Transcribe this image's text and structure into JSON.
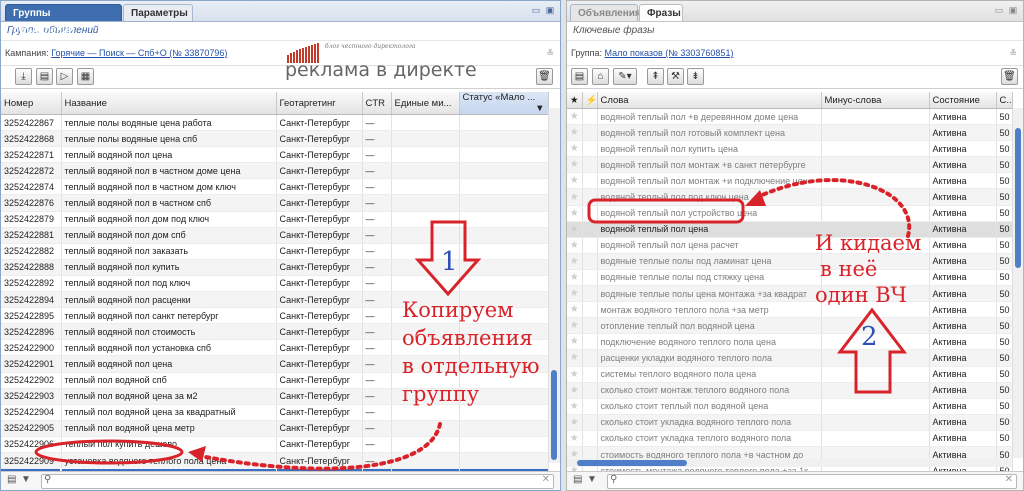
{
  "left": {
    "tabs": [
      {
        "label": "Группы объявлений"
      },
      {
        "label": "Параметры"
      }
    ],
    "subtitle": "Группы объявлений",
    "campaign_label": "Кампания:",
    "campaign_link": "Горячие — Поиск — Спб+О (№ 33870796)",
    "brand_small": "блог честного директолога",
    "brand_big": "реклама в директе",
    "columns": [
      "Номер",
      "Название",
      "Геотаргетинг",
      "CTR",
      "Единые ми...",
      "Статус «Мало ..."
    ],
    "rows": [
      [
        "3252422867",
        "теплые полы водяные цена работа",
        "Санкт-Петербург",
        "—"
      ],
      [
        "3252422868",
        "теплые полы водяные цена спб",
        "Санкт-Петербург",
        "—"
      ],
      [
        "3252422871",
        "теплый водяной пол цена",
        "Санкт-Петербург",
        "—"
      ],
      [
        "3252422872",
        "теплый водяной пол в частном доме цена",
        "Санкт-Петербург",
        "—"
      ],
      [
        "3252422874",
        "теплый водяной пол в частном дом ключ",
        "Санкт-Петербург",
        "—"
      ],
      [
        "3252422876",
        "теплый водяной пол в частном спб",
        "Санкт-Петербург",
        "—"
      ],
      [
        "3252422879",
        "теплый водяной пол дом под ключ",
        "Санкт-Петербург",
        "—"
      ],
      [
        "3252422881",
        "теплый водяной пол дом спб",
        "Санкт-Петербург",
        "—"
      ],
      [
        "3252422882",
        "теплый водяной пол заказать",
        "Санкт-Петербург",
        "—"
      ],
      [
        "3252422888",
        "теплый водяной пол купить",
        "Санкт-Петербург",
        "—"
      ],
      [
        "3252422892",
        "теплый водяной пол под ключ",
        "Санкт-Петербург",
        "—"
      ],
      [
        "3252422894",
        "теплый водяной пол расценки",
        "Санкт-Петербург",
        "—"
      ],
      [
        "3252422895",
        "теплый водяной пол санкт петербург",
        "Санкт-Петербург",
        "—"
      ],
      [
        "3252422896",
        "теплый водяной пол стоимость",
        "Санкт-Петербург",
        "—"
      ],
      [
        "3252422900",
        "теплый водяной пол установка спб",
        "Санкт-Петербург",
        "—"
      ],
      [
        "3252422901",
        "теплый водяной пол цена",
        "Санкт-Петербург",
        "—"
      ],
      [
        "3252422902",
        "теплый пол водяной спб",
        "Санкт-Петербург",
        "—"
      ],
      [
        "3252422903",
        "теплый пол водяной цена за м2",
        "Санкт-Петербург",
        "—"
      ],
      [
        "3252422904",
        "теплый пол водяной цена за квадратный",
        "Санкт-Петербург",
        "—"
      ],
      [
        "3252422905",
        "теплый пол водяной цена метр",
        "Санкт-Петербург",
        "—"
      ],
      [
        "3252422906",
        "теплый пол купить дешево",
        "Санкт-Петербург",
        "—"
      ],
      [
        "3252422909",
        "установка водяного теплого пола цена",
        "Санкт-Петербург",
        "—"
      ]
    ],
    "selected_row": [
      "33037",
      "0851",
      "Мало показов",
      "",
      "Санкт-Петербург",
      "—"
    ]
  },
  "right": {
    "tabs": [
      {
        "label": "Объявления"
      },
      {
        "label": "Фразы"
      }
    ],
    "subtitle": "Ключевые фразы",
    "group_label": "Группа:",
    "group_link": "Мало показов (№ 3303760851)",
    "columns": [
      "Слова",
      "Минус-слова",
      "Состояние",
      "С..."
    ],
    "rows": [
      [
        "водяной теплый пол +в деревянном доме цена",
        "Активна",
        "50"
      ],
      [
        "водяной теплый пол готовый комплект цена",
        "Активна",
        "50"
      ],
      [
        "водяной теплый пол купить цена",
        "Активна",
        "50"
      ],
      [
        "водяной теплый пол монтаж +в санкт петербурге",
        "Активна",
        "50"
      ],
      [
        "водяной теплый пол монтаж +и подключение цен",
        "Активна",
        "50"
      ],
      [
        "водяной теплый пол под ключ цена",
        "Активна",
        "50"
      ],
      [
        "водяной теплый пол устройство цена",
        "Активна",
        "50"
      ],
      [
        "водяной теплый пол цена",
        "Активна",
        "50"
      ],
      [
        "водяной теплый пол цена расчет",
        "Активна",
        "50"
      ],
      [
        "водяные теплые полы под ламинат цена",
        "Активна",
        "50"
      ],
      [
        "водяные теплые полы под стяжку цена",
        "Активна",
        "50"
      ],
      [
        "водяные теплые полы цена монтажа +за квадрат",
        "Активна",
        "50"
      ],
      [
        "монтаж водяного теплого пола +за метр",
        "Активна",
        "50"
      ],
      [
        "отопление теплый пол водяной цена",
        "Активна",
        "50"
      ],
      [
        "подключение водяного теплого пола цена",
        "Активна",
        "50"
      ],
      [
        "расценки укладки водяного теплого пола",
        "Активна",
        "50"
      ],
      [
        "системы теплого водяного пола цена",
        "Активна",
        "50"
      ],
      [
        "сколько стоит монтаж теплого водяного пола",
        "Активна",
        "50"
      ],
      [
        "сколько стоит теплый пол водяной цена",
        "Активна",
        "50"
      ],
      [
        "сколько стоит укладка водяного теплого пола",
        "Активна",
        "50"
      ],
      [
        "сколько стоит укладка теплого водяного пола",
        "Активна",
        "50"
      ],
      [
        "стоимость водяного теплого пола +в частном до",
        "Активна",
        "50"
      ],
      [
        "стоимость монтажа водяного теплого пола +за 1к",
        "Активна",
        "50"
      ],
      [
        "стоимость теплых водяных пол +в доме",
        "Активна",
        "50"
      ]
    ]
  },
  "annotations": {
    "num1": "1",
    "num2": "2",
    "left_text": [
      "Копируем",
      "объявления",
      "в отдельную",
      "группу"
    ],
    "right_text": [
      "И кидаем",
      "в неё",
      "один ВЧ"
    ],
    "color": "#d9232a"
  },
  "colors": {
    "accent": "#3e6db0",
    "selection": "#3a6fc5",
    "scroll_thumb": "#4f7fc8"
  }
}
